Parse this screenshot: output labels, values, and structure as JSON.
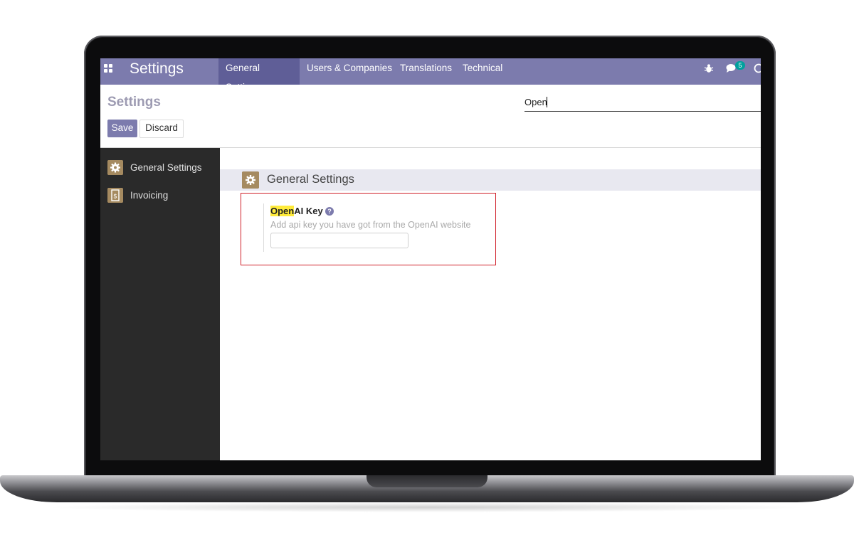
{
  "navbar": {
    "brand": "Settings",
    "menu": [
      "General Settings",
      "Users & Companies",
      "Translations",
      "Technical"
    ],
    "active_index": 0,
    "chat_count": "5"
  },
  "control_panel": {
    "title": "Settings",
    "search_value": "Open",
    "save_label": "Save",
    "discard_label": "Discard"
  },
  "sidebar": {
    "items": [
      {
        "label": "General Settings",
        "icon": "gear-icon"
      },
      {
        "label": "Invoicing",
        "icon": "invoice-icon"
      }
    ]
  },
  "content": {
    "section_title": "General Settings",
    "setting": {
      "label_highlight": "Open",
      "label_rest": "AI Key",
      "help_glyph": "?",
      "description": "Add api key you have got from the OpenAI website",
      "value": ""
    }
  },
  "colors": {
    "navbar": "#7c7bad",
    "navbar_active": "#5f5e97",
    "sidebar": "#2a2a2a",
    "highlight_border": "#d0202a",
    "search_highlight": "#ffeb3b"
  }
}
